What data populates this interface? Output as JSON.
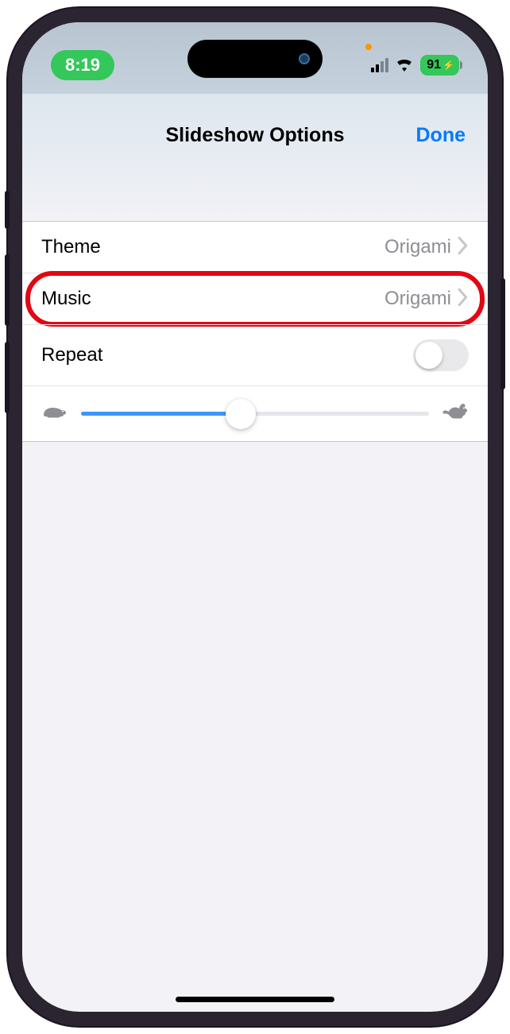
{
  "status_bar": {
    "time": "8:19",
    "battery_percent": "91",
    "battery_icon": "⚡"
  },
  "header": {
    "title": "Slideshow Options",
    "done_label": "Done"
  },
  "rows": {
    "theme": {
      "label": "Theme",
      "value": "Origami"
    },
    "music": {
      "label": "Music",
      "value": "Origami"
    },
    "repeat": {
      "label": "Repeat",
      "enabled": false
    }
  },
  "slider": {
    "position_percent": 46
  }
}
